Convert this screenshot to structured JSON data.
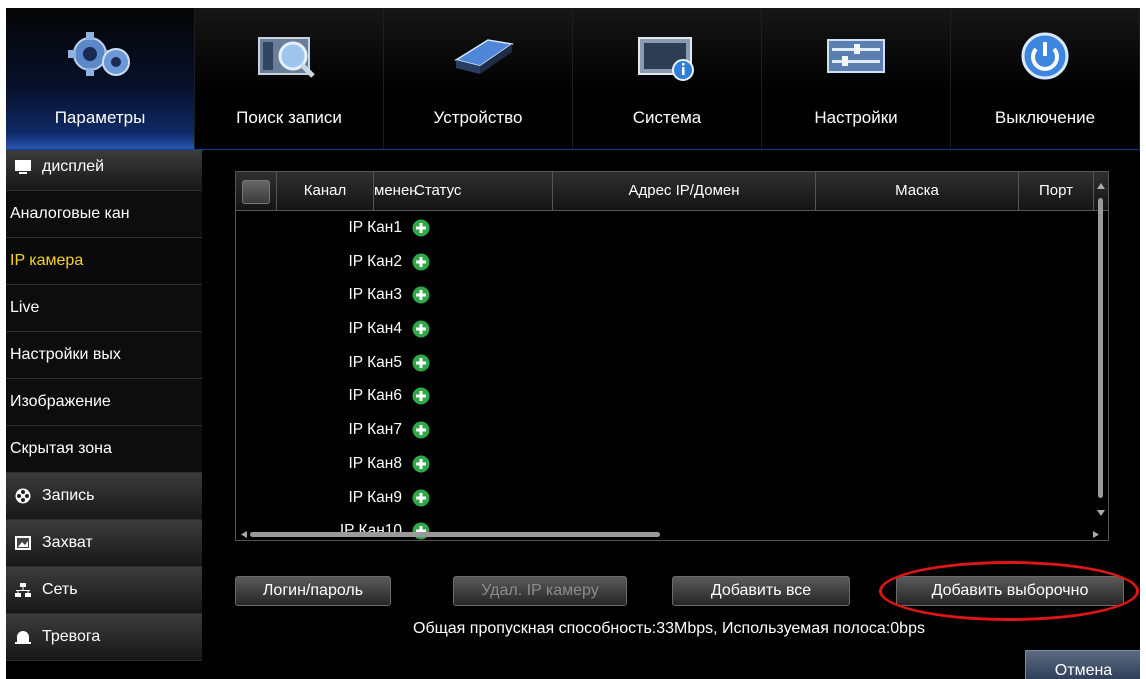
{
  "toolbar": {
    "items": [
      {
        "label": "Параметры",
        "icon": "gears-icon"
      },
      {
        "label": "Поиск записи",
        "icon": "search-record-icon"
      },
      {
        "label": "Устройство",
        "icon": "hdd-icon"
      },
      {
        "label": "Система",
        "icon": "system-info-icon"
      },
      {
        "label": "Настройки",
        "icon": "sliders-icon"
      },
      {
        "label": "Выключение",
        "icon": "power-icon"
      }
    ],
    "active_index": 0
  },
  "sidebar": {
    "items": [
      {
        "label": "дисплей",
        "type": "category",
        "icon": "monitor-icon"
      },
      {
        "label": "Аналоговые кан",
        "type": "sub"
      },
      {
        "label": "IP камера",
        "type": "sub",
        "selected": true
      },
      {
        "label": "Live",
        "type": "sub"
      },
      {
        "label": "Настройки вых",
        "type": "sub"
      },
      {
        "label": "Изображение",
        "type": "sub"
      },
      {
        "label": "Скрытая зона",
        "type": "sub"
      },
      {
        "label": "Запись",
        "type": "category",
        "icon": "film-reel-icon"
      },
      {
        "label": "Захват",
        "type": "category",
        "icon": "capture-icon"
      },
      {
        "label": "Сеть",
        "type": "category",
        "icon": "network-icon"
      },
      {
        "label": "Тревога",
        "type": "category",
        "icon": "alarm-icon"
      }
    ]
  },
  "table": {
    "columns": [
      "Канал",
      "менен",
      "Статус",
      "Адрес IP/Домен",
      "Маска",
      "Порт"
    ],
    "rows": [
      "IP Кан1",
      "IP Кан2",
      "IP Кан3",
      "IP Кан4",
      "IP Кан5",
      "IP Кан6",
      "IP Кан7",
      "IP Кан8",
      "IP Кан9",
      "IP Кан10"
    ]
  },
  "buttons": {
    "login": "Логин/пароль",
    "delete": "Удал. IP камеру",
    "add_all": "Добавить все",
    "add_selected": "Добавить выборочно",
    "cancel": "Отмена"
  },
  "bandwidth_text": "Общая пропускная способность:33Mbps, Используемая полоса:0bps",
  "colors": {
    "selected_text": "#f5d328",
    "accent_blue": "#2a59b8",
    "add_icon": "#2fa84a",
    "highlight_ring": "#e01515"
  }
}
